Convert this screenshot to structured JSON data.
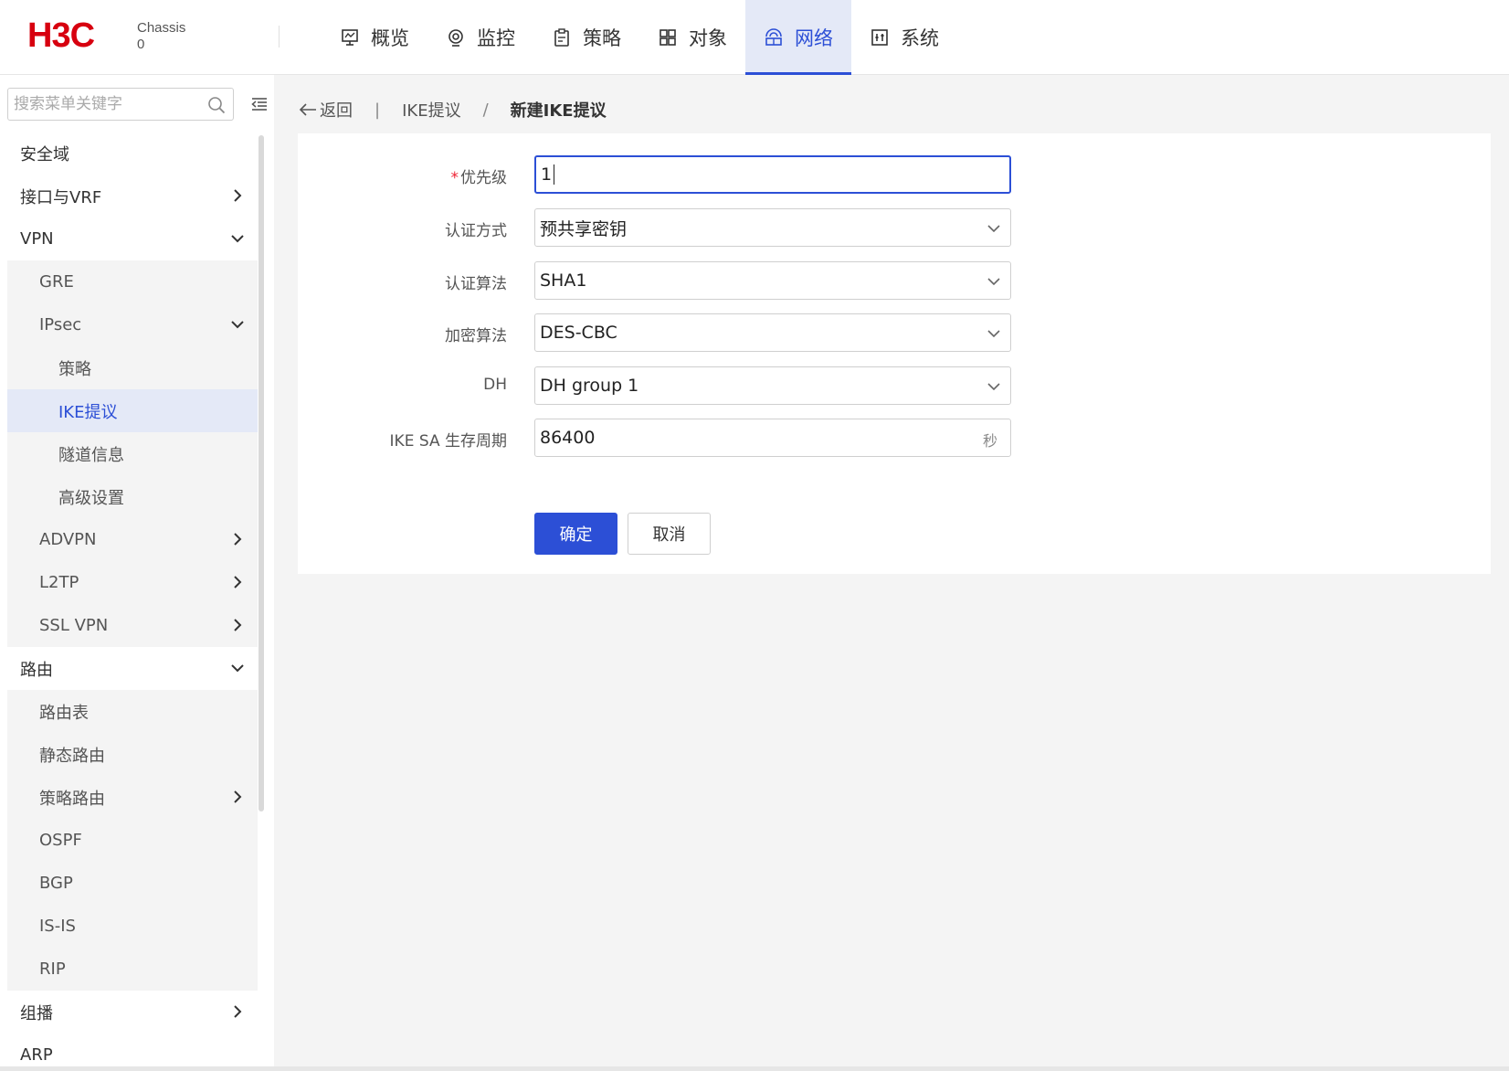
{
  "header": {
    "logo": "H3C",
    "chassis_line1": "Chassis",
    "chassis_line2": "0",
    "nav": [
      {
        "label": "概览",
        "icon": "monitor-icon"
      },
      {
        "label": "监控",
        "icon": "target-icon"
      },
      {
        "label": "策略",
        "icon": "clipboard-icon"
      },
      {
        "label": "对象",
        "icon": "grid-icon"
      },
      {
        "label": "网络",
        "icon": "network-icon",
        "active": true
      },
      {
        "label": "系统",
        "icon": "system-icon"
      }
    ]
  },
  "sidebar": {
    "search_placeholder": "搜索菜单关键字",
    "items": [
      {
        "label": "安全域"
      },
      {
        "label": "接口与VRF"
      },
      {
        "label": "VPN"
      },
      {
        "label": "GRE"
      },
      {
        "label": "IPsec"
      },
      {
        "label": "策略"
      },
      {
        "label": "IKE提议"
      },
      {
        "label": "隧道信息"
      },
      {
        "label": "高级设置"
      },
      {
        "label": "ADVPN"
      },
      {
        "label": "L2TP"
      },
      {
        "label": "SSL VPN"
      },
      {
        "label": "路由"
      },
      {
        "label": "路由表"
      },
      {
        "label": "静态路由"
      },
      {
        "label": "策略路由"
      },
      {
        "label": "OSPF"
      },
      {
        "label": "BGP"
      },
      {
        "label": "IS-IS"
      },
      {
        "label": "RIP"
      },
      {
        "label": "组播"
      },
      {
        "label": "ARP"
      }
    ]
  },
  "breadcrumb": {
    "back": "返回",
    "divider": "|",
    "parent": "IKE提议",
    "slash": "/",
    "current": "新建IKE提议"
  },
  "form": {
    "priority": {
      "required_mark": "*",
      "label": "优先级",
      "value": "1"
    },
    "auth_method": {
      "label": "认证方式",
      "value": "预共享密钥"
    },
    "auth_algorithm": {
      "label": "认证算法",
      "value": "SHA1"
    },
    "encryption_algorithm": {
      "label": "加密算法",
      "value": "DES-CBC"
    },
    "dh": {
      "label": "DH",
      "value": "DH group 1"
    },
    "sa_lifetime": {
      "label": "IKE SA 生存周期",
      "value": "86400",
      "unit": "秒"
    },
    "ok_button": "确定",
    "cancel_button": "取消"
  },
  "colors": {
    "brand_red": "#d7000f",
    "accent_blue": "#2c4fd6",
    "selected_bg": "#e4e9f7"
  }
}
